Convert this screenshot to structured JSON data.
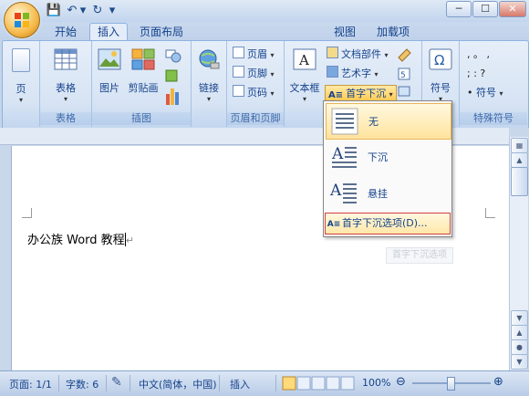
{
  "qat": {
    "save": "💾",
    "undo": "↶",
    "redo": "↻",
    "more": "▾"
  },
  "window": {
    "min": "─",
    "max": "☐",
    "close": "✕"
  },
  "tabs": [
    "开始",
    "插入",
    "页面布局",
    "视图",
    "加载项"
  ],
  "ribbon": {
    "page_label": "页",
    "table_label": "表格",
    "picture_label": "图片",
    "clipart_label": "剪贴画",
    "link_label": "链接",
    "header_label": "页眉",
    "footer_label": "页脚",
    "pagenum_label": "页码",
    "textbox_label": "文本框",
    "quickparts_label": "文档部件",
    "wordart_label": "艺术字",
    "dropcap_label": "首字下沉",
    "symbol_label": "符号",
    "special_row1": ",   。   ,",
    "special_row2": ";   :   ?",
    "special_row3": "符号",
    "groups": {
      "table": "表格",
      "illustrations": "插图",
      "headerfooter": "页眉和页脚",
      "special": "特殊符号"
    }
  },
  "document": {
    "text": "办公族 Word 教程",
    "pilcrow": "↵"
  },
  "dropdown": {
    "items": [
      "无",
      "下沉",
      "悬挂"
    ],
    "options_label": "首字下沉选项(D)..."
  },
  "ghost_tip": "首字下沉选项",
  "status": {
    "page": "页面: 1/1",
    "words": "字数: 6",
    "language": "中文(简体，中国)",
    "mode": "插入",
    "zoom": "100%"
  }
}
